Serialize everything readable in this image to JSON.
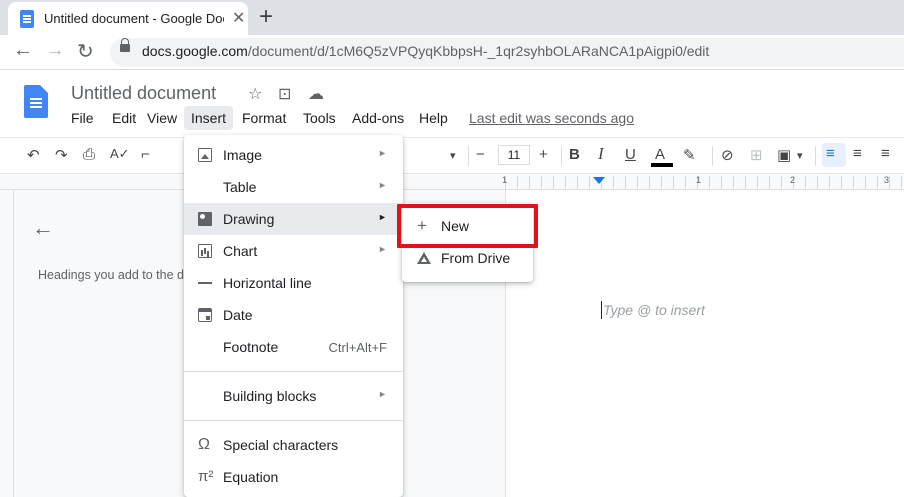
{
  "browser": {
    "tab_title": "Untitled document - Google Docs",
    "tab_close": "✕",
    "new_tab": "+",
    "url_host": "docs.google.com",
    "url_path": "/document/d/1cM6Q5zVPQyqKbbpsH-_1qr2syhbOLARaNCA1pAigpi0/edit",
    "nav": {
      "back": "←",
      "forward": "→",
      "reload": "↻"
    }
  },
  "docs": {
    "title": "Untitled document",
    "menus": [
      "File",
      "Edit",
      "View",
      "Insert",
      "Format",
      "Tools",
      "Add-ons",
      "Help"
    ],
    "active_menu": "Insert",
    "last_edit": "Last edit was seconds ago",
    "header_icons": {
      "star": "☆",
      "folder": "⊡",
      "cloud": "☁"
    }
  },
  "toolbar": {
    "undo": "↶",
    "redo": "↷",
    "print": "⎙",
    "spell": "A✓",
    "paint": "⌐",
    "font_size": "11",
    "minus": "−",
    "plus": "+",
    "bold": "B",
    "italic": "I",
    "underline": "U",
    "text_color": "A",
    "highlight": "✎",
    "link": "⊘",
    "comment": "⊞",
    "image": "▣",
    "align_left": "≡",
    "align_center": "≡",
    "align_right": "≡",
    "dropdown": "▾"
  },
  "ruler": {
    "labels": [
      "1",
      "1",
      "2",
      "3"
    ]
  },
  "outline": {
    "back": "←",
    "hint": "Headings you add to the document will appear here."
  },
  "page": {
    "placeholder": "Type @ to insert"
  },
  "insert_menu": {
    "items": [
      {
        "label": "Image",
        "icon": "image-icon",
        "submenu": true
      },
      {
        "label": "Table",
        "icon": "",
        "submenu": true
      },
      {
        "label": "Drawing",
        "icon": "drawing-icon",
        "submenu": true
      },
      {
        "label": "Chart",
        "icon": "chart-icon",
        "submenu": true
      },
      {
        "label": "Horizontal line",
        "icon": "horizontal-line-icon",
        "submenu": false
      },
      {
        "label": "Date",
        "icon": "date-icon",
        "submenu": false
      },
      {
        "label": "Footnote",
        "icon": "",
        "shortcut": "Ctrl+Alt+F"
      },
      {
        "label": "Building blocks",
        "icon": "",
        "submenu": true
      },
      {
        "label": "Special characters",
        "icon": "omega-icon",
        "glyph": "Ω"
      },
      {
        "label": "Equation",
        "icon": "pi-icon",
        "glyph": "π²"
      }
    ],
    "arrow": "►"
  },
  "drawing_submenu": {
    "new_label": "New",
    "new_icon": "+",
    "from_drive_label": "From Drive"
  },
  "colors": {
    "accent": "#1a73e8",
    "highlight_box": "#e0121a",
    "docs_blue": "#4285f4"
  }
}
